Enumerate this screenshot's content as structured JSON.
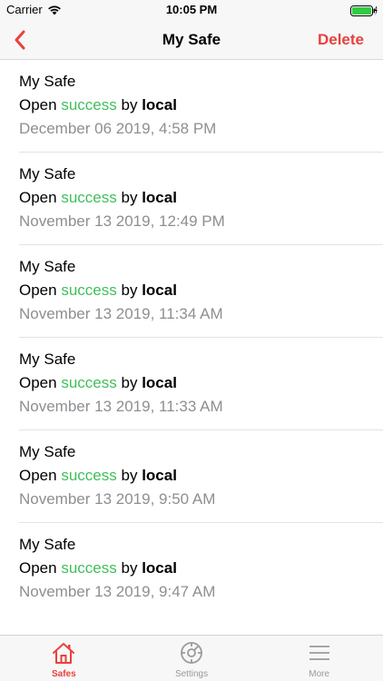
{
  "status_bar": {
    "carrier": "Carrier",
    "time": "10:05 PM",
    "battery_color": "#2ecc40"
  },
  "nav": {
    "title": "My Safe",
    "delete_label": "Delete",
    "accent_color": "#e8413d"
  },
  "log_entries": [
    {
      "title": "My Safe",
      "prefix": "Open",
      "status": "success",
      "by": "by",
      "actor": "local",
      "date": "December 06 2019, 4:58 PM"
    },
    {
      "title": "My Safe",
      "prefix": "Open",
      "status": "success",
      "by": "by",
      "actor": "local",
      "date": "November 13 2019, 12:49 PM"
    },
    {
      "title": "My Safe",
      "prefix": "Open",
      "status": "success",
      "by": "by",
      "actor": "local",
      "date": "November 13 2019, 11:34 AM"
    },
    {
      "title": "My Safe",
      "prefix": "Open",
      "status": "success",
      "by": "by",
      "actor": "local",
      "date": "November 13 2019, 11:33 AM"
    },
    {
      "title": "My Safe",
      "prefix": "Open",
      "status": "success",
      "by": "by",
      "actor": "local",
      "date": "November 13 2019, 9:50 AM"
    },
    {
      "title": "My Safe",
      "prefix": "Open",
      "status": "success",
      "by": "by",
      "actor": "local",
      "date": "November 13 2019, 9:47 AM"
    }
  ],
  "tab_bar": {
    "tabs": [
      {
        "label": "Safes",
        "icon": "home-icon",
        "active": true
      },
      {
        "label": "Settings",
        "icon": "settings-dial-icon",
        "active": false
      },
      {
        "label": "More",
        "icon": "menu-lines-icon",
        "active": false
      }
    ]
  }
}
